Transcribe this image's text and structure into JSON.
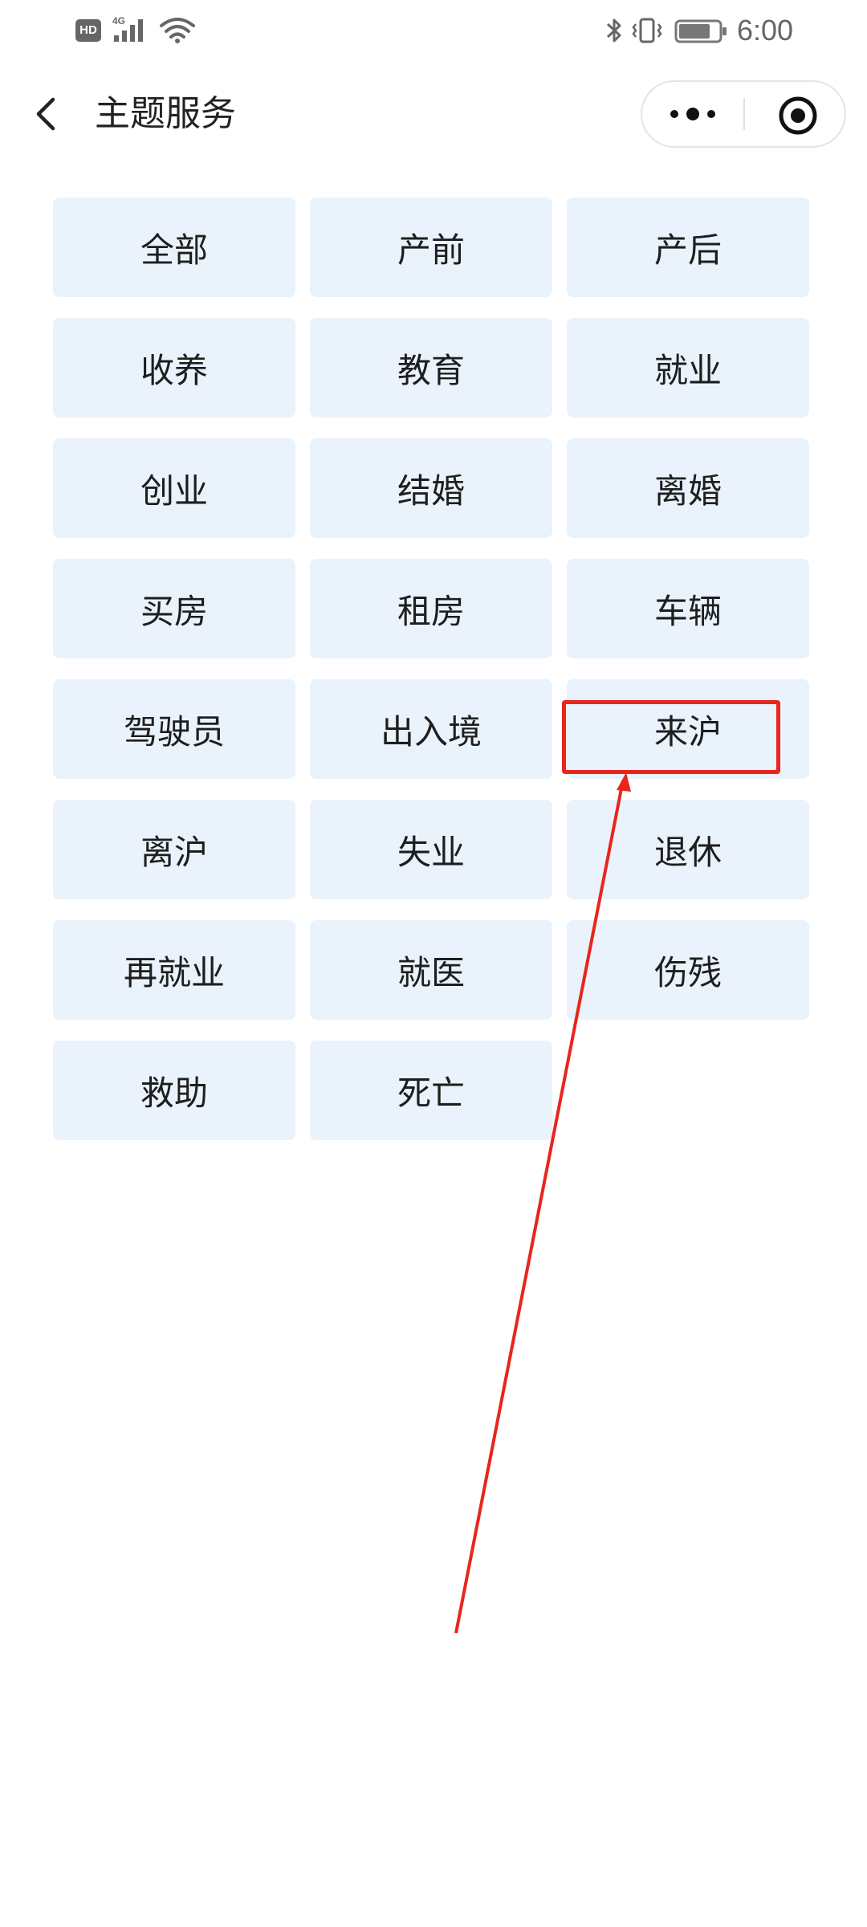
{
  "status_bar": {
    "hd_label": "HD",
    "network_label": "4G",
    "time": "6:00",
    "icons": [
      "hd-icon",
      "signal-icon",
      "wifi-icon",
      "bluetooth-icon",
      "vibrate-icon",
      "battery-icon"
    ],
    "battery_level": 0.8
  },
  "nav": {
    "title": "主题服务",
    "back_icon": "chevron-left-icon",
    "more_icon": "more-dots-icon",
    "close_icon": "target-close-icon"
  },
  "categories": [
    "全部",
    "产前",
    "产后",
    "收养",
    "教育",
    "就业",
    "创业",
    "结婚",
    "离婚",
    "买房",
    "租房",
    "车辆",
    "驾驶员",
    "出入境",
    "来沪",
    "离沪",
    "失业",
    "退休",
    "再就业",
    "就医",
    "伤残",
    "救助",
    "死亡"
  ],
  "annotation": {
    "highlighted_item": "来沪",
    "color": "#e8261d"
  },
  "colors": {
    "tile_background": "#eaf3fb",
    "text": "#1e1e1e",
    "annotation": "#e8261d"
  }
}
